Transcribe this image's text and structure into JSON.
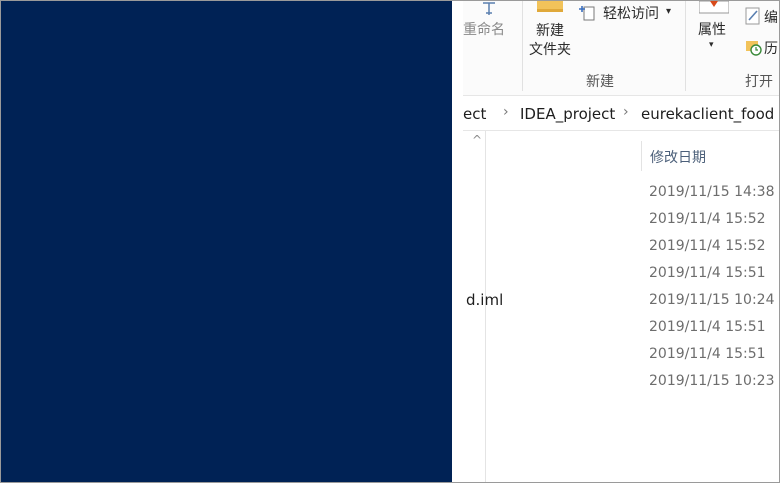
{
  "ribbon": {
    "rename_label": "重命名",
    "new_folder_label_line1": "新建",
    "new_folder_label_line2": "文件夹",
    "easy_access_label": "轻松访问",
    "properties_label": "属性",
    "edit_label": "编",
    "history_label": "历",
    "group_new_label": "新建",
    "group_open_label": "打开"
  },
  "address": {
    "crumbs": [
      "ect",
      "IDEA_project",
      "eurekaclient_food"
    ]
  },
  "file_list": {
    "column_modified": "修改日期",
    "rows": [
      {
        "name": "",
        "modified": "2019/11/15 14:38"
      },
      {
        "name": "",
        "modified": "2019/11/4 15:52"
      },
      {
        "name": "",
        "modified": "2019/11/4 15:52"
      },
      {
        "name": "",
        "modified": "2019/11/4 15:51"
      },
      {
        "name": "d.iml",
        "modified": "2019/11/15 10:24"
      },
      {
        "name": "",
        "modified": "2019/11/4 15:51"
      },
      {
        "name": "",
        "modified": "2019/11/4 15:51"
      },
      {
        "name": "",
        "modified": "2019/11/15 10:23"
      }
    ]
  },
  "colors": {
    "desktop_background": "#002255",
    "folder_icon": "#f2c35a",
    "properties_icon": "#d84a1b"
  }
}
